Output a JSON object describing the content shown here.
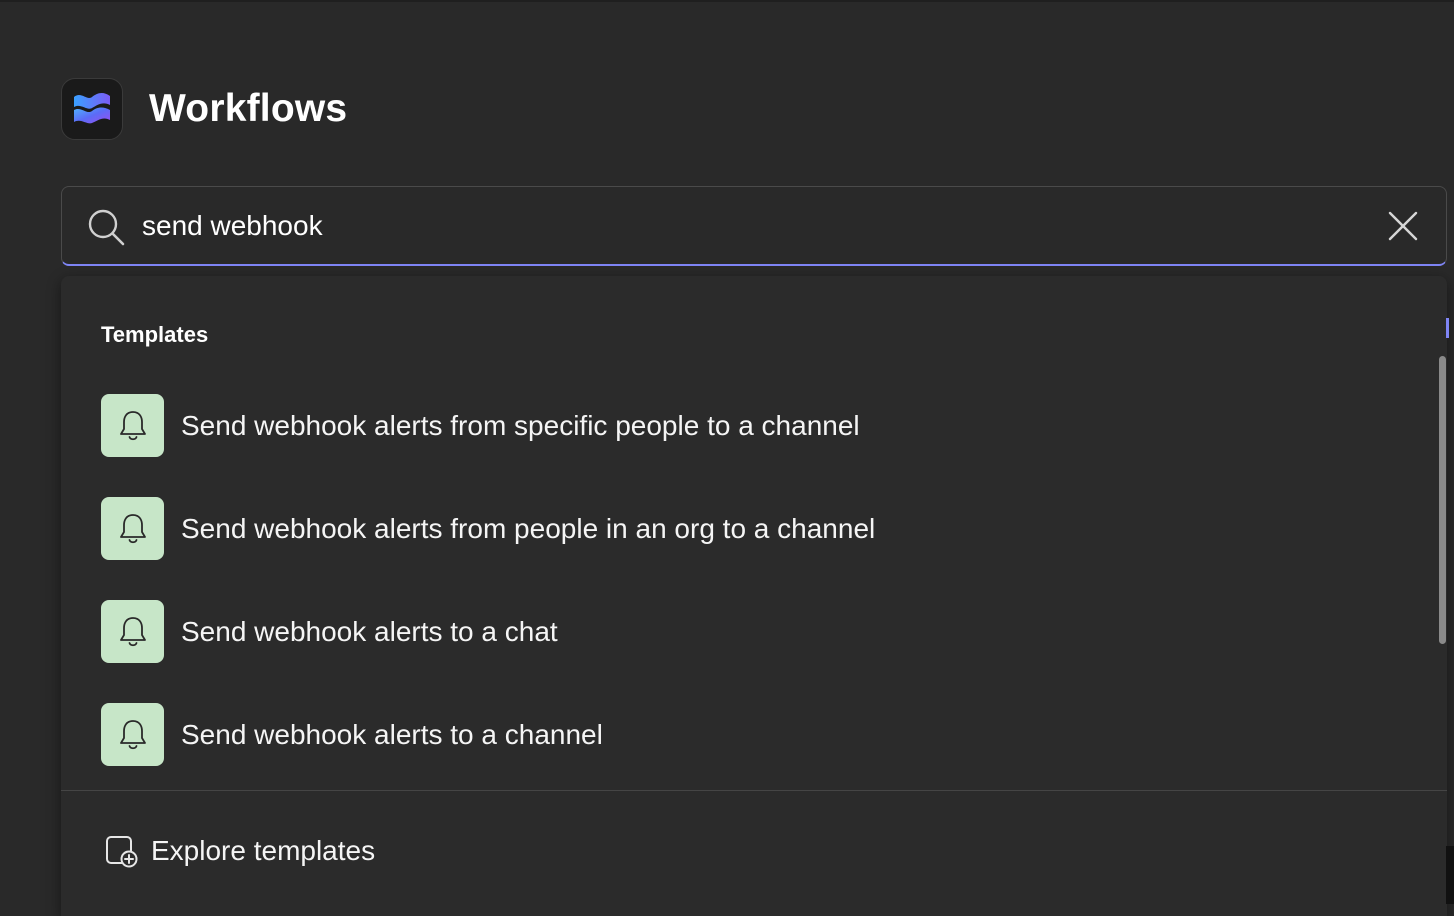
{
  "app": {
    "title": "Workflows",
    "logo_icon": "workflows-logo-icon"
  },
  "search": {
    "value": "send webhook",
    "search_icon": "search-icon",
    "clear_icon": "close-icon"
  },
  "dropdown": {
    "section_title": "Templates",
    "templates": [
      {
        "label": "Send webhook alerts from specific people to a channel",
        "icon": "bell-icon"
      },
      {
        "label": "Send webhook alerts from people in an org to a channel",
        "icon": "bell-icon"
      },
      {
        "label": "Send webhook alerts to a chat",
        "icon": "bell-icon"
      },
      {
        "label": "Send webhook alerts to a channel",
        "icon": "bell-icon"
      }
    ],
    "explore_label": "Explore templates",
    "explore_icon": "explore-templates-icon"
  },
  "colors": {
    "background": "#292929",
    "accent": "#7f85f5",
    "template_icon_bg": "#c7e6c8"
  }
}
